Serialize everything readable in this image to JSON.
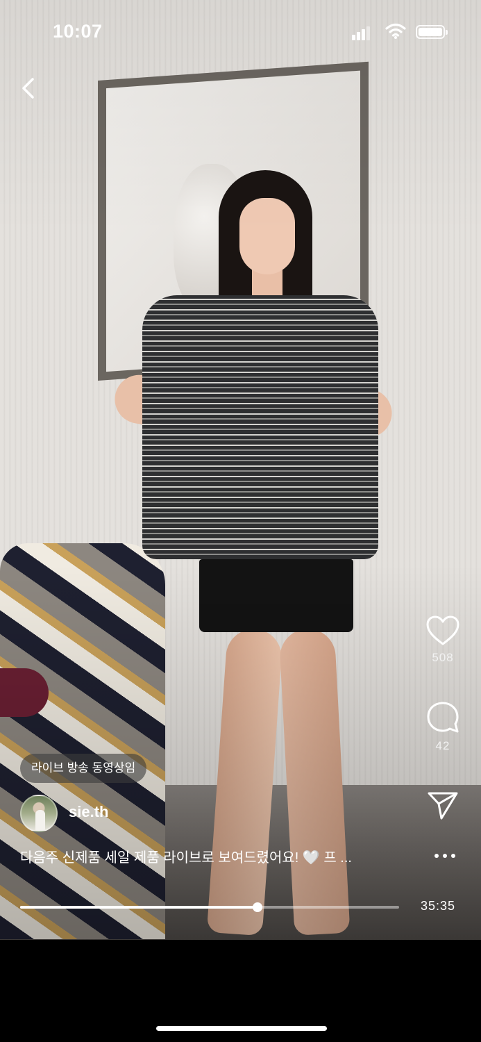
{
  "status_bar": {
    "time": "10:07",
    "battery_percent": 100
  },
  "icons": {
    "back": "chevron-left-icon",
    "like": "heart-icon",
    "comment": "comment-bubble-icon",
    "share": "paper-plane-icon",
    "more": "more-horizontal-icon"
  },
  "actions": {
    "likes_count": "508",
    "comments_count": "42"
  },
  "post": {
    "badge": "라이브 방송 동영상임",
    "username": "sie.th",
    "caption": "다음주 신제품 세일 제품 라이브로 보여드렸어요! 🤍 프 ..."
  },
  "player": {
    "progress_fraction": 0.627,
    "duration": "35:35"
  }
}
